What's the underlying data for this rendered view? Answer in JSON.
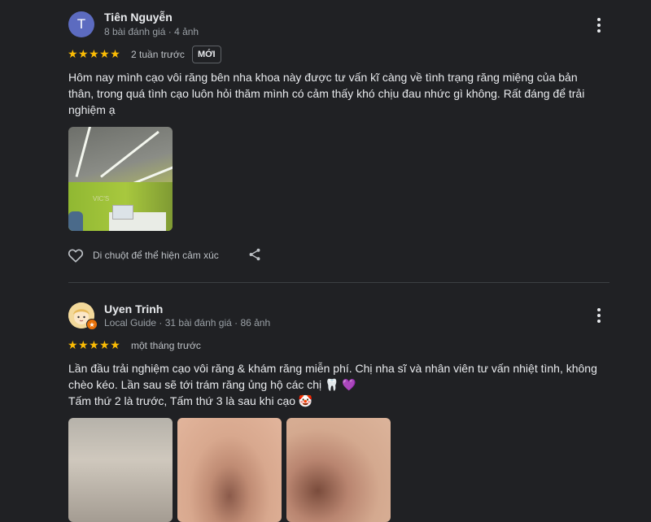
{
  "reviews": [
    {
      "author": "Tiên Nguyễn",
      "avatar_letter": "T",
      "meta": "8 bài đánh giá · 4 ảnh",
      "stars": "★★★★★",
      "when": "2 tuần trước",
      "new_tag": "MỚI",
      "text": "Hôm nay mình cạo vôi răng bên nha khoa này được tư vấn kĩ càng về tình trạng răng miệng của bản\nthân, trong quá tình cạo luôn hỏi thăm mình có cảm thấy khó chịu đau nhức gì không. Rất đáng để trải\nnghiệm ạ",
      "photo_sign": "VIC'S",
      "reaction_label": "Di chuột để thể hiện cảm xúc"
    },
    {
      "author": "Uyen Trinh",
      "meta": "Local Guide · 31 bài đánh giá · 86 ảnh",
      "stars": "★★★★★",
      "when": "một tháng trước",
      "text": "Lần đầu trải nghiệm cạo vôi răng & khám răng miễn phí. Chị nha sĩ và nhân viên tư vấn nhiệt tình, không\nchèo kéo. Lần sau sẽ tới trám răng ủng hộ các chị 🦷 💜\nTấm thứ 2 là trước, Tấm thứ 3 là sau khi cạo 🤡"
    }
  ],
  "icons": {
    "heart": "heart-outline-icon",
    "share": "share-icon",
    "more": "more-vert-icon"
  },
  "colors": {
    "background": "#202124",
    "star": "#fbbc04",
    "avatar": "#5c6bc0"
  }
}
